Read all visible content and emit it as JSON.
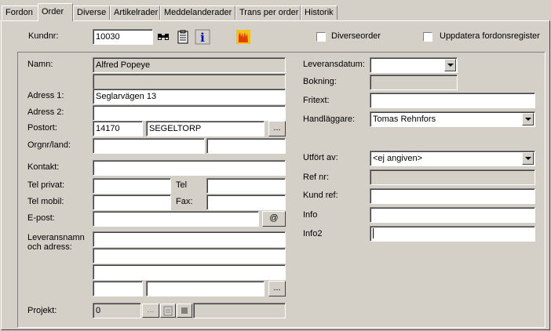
{
  "tabs": [
    "Fordon",
    "Order",
    "Diverse",
    "Artikelrader",
    "Meddelanderader",
    "Trans per order",
    "Historik"
  ],
  "top": {
    "kundnr_label": "Kundnr:",
    "kundnr_value": "10030",
    "diverseorder_label": "Diverseorder",
    "uppdatera_label": "Uppdatera fordonsregister"
  },
  "left": {
    "namn_label": "Namn:",
    "namn_value": "Alfred Popeye",
    "adress1_label": "Adress 1:",
    "adress1_value": "Seglarvägen 13",
    "adress2_label": "Adress 2:",
    "postort_label": "Postort:",
    "postnr_value": "14170",
    "ort_value": "SEGELTORP",
    "orgnr_label": "Orgnr/land:",
    "kontakt_label": "Kontakt:",
    "telprivat_label": "Tel privat:",
    "tel_label": "Tel",
    "telmobil_label": "Tel mobil:",
    "fax_label": "Fax:",
    "epost_label": "E-post:",
    "at_label": "@",
    "leverans_label_1": "Leveransnamn",
    "leverans_label_2": "och adress:",
    "ellipsis": "...",
    "projekt_label": "Projekt:",
    "projekt_value": "0"
  },
  "right": {
    "leveransdatum_label": "Leveransdatum:",
    "bokning_label": "Bokning:",
    "fritext_label": "Fritext:",
    "handlaggare_label": "Handläggare:",
    "handlaggare_value": "Tomas Rehnfors",
    "utfort_label": "Utfört av:",
    "utfort_value": "<ej angiven>",
    "refnr_label": "Ref nr:",
    "kundref_label": "Kund ref:",
    "info_label": "Info",
    "info2_label": "Info2"
  },
  "icons": {
    "search": "binoculars-icon",
    "notes": "notepad-icon",
    "info": "info-icon",
    "flame": "flame-icon"
  },
  "colors": {
    "face": "#d4d0c8",
    "info_blue": "#0000c0",
    "flame": "#e04000"
  }
}
